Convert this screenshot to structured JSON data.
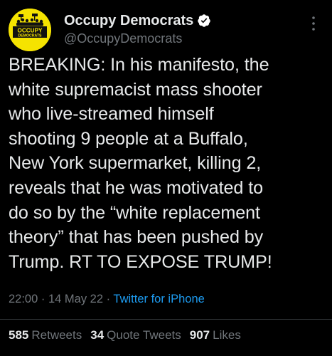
{
  "colors": {
    "background": "#000000",
    "text_primary": "#e7e9ea",
    "text_secondary": "#71767b",
    "link": "#1d9bf0",
    "avatar_yellow": "#f5e300",
    "divider": "#2f3336"
  },
  "author": {
    "display_name": "Occupy Democrats",
    "handle": "@OccupyDemocrats",
    "verified_icon": "verified-badge-icon",
    "avatar_text_top": "OCCUPY",
    "avatar_text_bottom": "DEMOCRATS"
  },
  "tweet": {
    "lines": [
      "BREAKING: In his manifesto, the",
      "white supremacist mass shooter",
      "who live-streamed himself",
      "shooting 9 people at a Buffalo,",
      "New York supermarket, killing 2,",
      "reveals that he was motivated to",
      "do so by the “white replacement",
      "theory” that has been pushed by",
      "Trump. RT TO EXPOSE TRUMP!"
    ]
  },
  "meta": {
    "time": "22:00",
    "separator": "·",
    "date": "14 May 22",
    "source": "Twitter for iPhone"
  },
  "stats": {
    "retweets_count": "585",
    "retweets_label": "Retweets",
    "quotes_count": "34",
    "quotes_label": "Quote Tweets",
    "likes_count": "907",
    "likes_label": "Likes"
  },
  "icons": {
    "more": "more-vertical-icon"
  }
}
